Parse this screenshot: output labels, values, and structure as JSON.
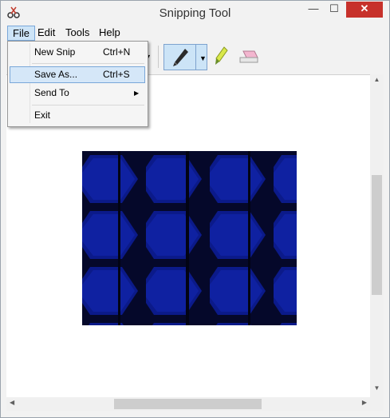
{
  "window": {
    "title": "Snipping Tool",
    "controls": {
      "minimize": "—",
      "maximize": "☐",
      "close": "✕"
    }
  },
  "menubar": {
    "items": [
      {
        "label": "File"
      },
      {
        "label": "Edit"
      },
      {
        "label": "Tools"
      },
      {
        "label": "Help"
      }
    ]
  },
  "file_menu": {
    "items": [
      {
        "label": "New Snip",
        "shortcut": "Ctrl+N"
      },
      {
        "label": "Save As...",
        "shortcut": "Ctrl+S",
        "highlighted": true
      },
      {
        "label": "Send To",
        "submenu": true
      },
      {
        "label": "Exit"
      }
    ]
  },
  "toolbar": {
    "tools": [
      "pen-icon",
      "highlighter-icon",
      "eraser-icon"
    ],
    "active_tool": "pen"
  },
  "scrollbars": {
    "arrow_up": "▲",
    "arrow_down": "▼",
    "arrow_left": "◀",
    "arrow_right": "▶",
    "submenu_arrow": "▶",
    "dropdown_arrow": "▼"
  },
  "colors": {
    "close_button": "#c7312b",
    "highlight": "#cde4f7",
    "snip_background": "#0a0f5c"
  }
}
